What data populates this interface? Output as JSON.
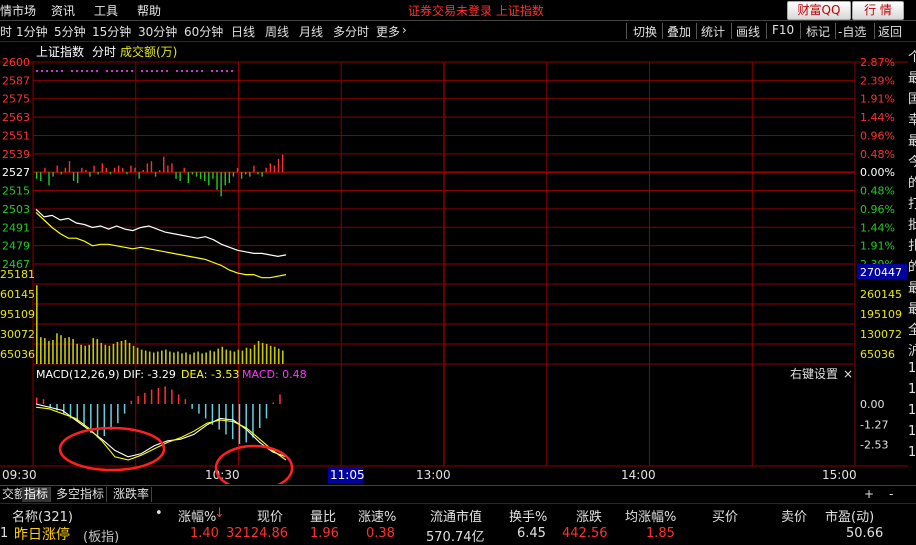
{
  "menu": {
    "items": [
      "情市场",
      "资讯",
      "工具",
      "帮助"
    ],
    "notice": "证券交易未登录 上证指数",
    "btn_caifu": "财富QQ",
    "btn_hangqing": "行 情"
  },
  "toolbar": {
    "periods": [
      "时",
      "1分钟",
      "5分钟",
      "15分钟",
      "30分钟",
      "60分钟",
      "日线",
      "周线",
      "月线",
      "多分时",
      "更多"
    ],
    "more_arrow": "›",
    "buttons": [
      "切换",
      "叠加",
      "统计",
      "画线",
      "F10",
      "标记",
      "-自选",
      "返回"
    ]
  },
  "chart": {
    "index_name": "上证指数",
    "mode": "分时",
    "volume_label": "成交额(万)",
    "macd_label": "MACD(12,26,9)",
    "dif_label": "DIF: -3.29",
    "dea_label": "DEA: -3.53",
    "macd_value": "MACD: 0.48",
    "macd_settings": "右键设置",
    "close_icon": "×",
    "cursor_value": "270447",
    "time_labels": [
      "09:30",
      "10:30",
      "11:05",
      "13:00",
      "14:00",
      "15:00"
    ],
    "macd_right_labels": [
      "0.00",
      "-1.27",
      "-2.53"
    ]
  },
  "chart_data": {
    "type": "line",
    "price_axis": [
      2600,
      2587,
      2575,
      2563,
      2551,
      2539,
      2527,
      2515,
      2503,
      2491,
      2479,
      2467
    ],
    "pct_axis": [
      "2.87%",
      "2.39%",
      "1.91%",
      "1.44%",
      "0.96%",
      "0.48%",
      "0.00%",
      "0.48%",
      "0.96%",
      "1.44%",
      "1.91%",
      "2.39%"
    ],
    "volume_axis_left": [
      "25181",
      "60145",
      "95109",
      "30072",
      "65036"
    ],
    "volume_axis_right": [
      "325181",
      "260145",
      "195109",
      "130072",
      "65036"
    ],
    "white_line": [
      2503,
      2498,
      2499,
      2496,
      2497,
      2494,
      2493,
      2491,
      2492,
      2490,
      2492,
      2490,
      2489,
      2491,
      2492,
      2490,
      2488,
      2487,
      2486,
      2485,
      2484,
      2485,
      2483,
      2480,
      2478,
      2476,
      2475,
      2474,
      2474,
      2473,
      2472,
      2473
    ],
    "yellow_line": [
      2501,
      2496,
      2491,
      2487,
      2484,
      2484,
      2482,
      2479,
      2480,
      2480,
      2479,
      2478,
      2477,
      2478,
      2477,
      2476,
      2475,
      2474,
      2473,
      2472,
      2471,
      2470,
      2468,
      2466,
      2463,
      2461,
      2460,
      2460,
      2458,
      2458,
      2459,
      2460
    ],
    "bars": [
      -3,
      -4,
      2,
      -6,
      -2,
      3,
      -1,
      2,
      5,
      -4,
      -5,
      2,
      1,
      -2,
      3,
      -1,
      4,
      2,
      -1,
      2,
      3,
      2,
      -1,
      3,
      2,
      -3,
      1,
      4,
      5,
      -2,
      1,
      7,
      3,
      4,
      -3,
      -4,
      2,
      -5,
      -1,
      -2,
      -3,
      -4,
      -6,
      -3,
      -8,
      -11,
      -6,
      -5,
      -2,
      2,
      -3,
      -1,
      -2,
      3,
      -1,
      -2,
      2,
      4,
      3,
      6,
      8
    ],
    "volume": [
      0.82,
      0.28,
      0.27,
      0.24,
      0.25,
      0.32,
      0.3,
      0.27,
      0.28,
      0.26,
      0.21,
      0.2,
      0.19,
      0.2,
      0.27,
      0.26,
      0.22,
      0.2,
      0.19,
      0.21,
      0.23,
      0.24,
      0.25,
      0.22,
      0.19,
      0.17,
      0.15,
      0.14,
      0.13,
      0.12,
      0.13,
      0.14,
      0.15,
      0.13,
      0.12,
      0.13,
      0.11,
      0.12,
      0.1,
      0.12,
      0.13,
      0.11,
      0.12,
      0.14,
      0.13,
      0.16,
      0.18,
      0.15,
      0.14,
      0.13,
      0.15,
      0.14,
      0.17,
      0.16,
      0.2,
      0.24,
      0.22,
      0.21,
      0.19,
      0.18,
      0.16,
      0.14
    ],
    "macd_bars": [
      0.4,
      0.3,
      -0.2,
      -0.4,
      -0.6,
      -0.9,
      -1.1,
      -1.4,
      -1.8,
      -2.1,
      -2.0,
      -1.6,
      -1.2,
      -0.6,
      0.2,
      0.5,
      0.7,
      0.9,
      1.0,
      1.1,
      0.9,
      0.6,
      0.3,
      -0.3,
      -0.6,
      -0.9,
      -1.3,
      -1.6,
      -1.9,
      -2.2,
      -2.5,
      -2.4,
      -2.1,
      -1.5,
      -0.9,
      0.1,
      0.6
    ],
    "dif_line": [
      0.0,
      -0.2,
      -0.4,
      -1.0,
      -1.6,
      -2.2,
      -2.9,
      -3.3,
      -3.1,
      -2.6,
      -2.3,
      -2.2,
      -1.9,
      -1.3,
      -0.9,
      -1.0,
      -1.6,
      -2.4,
      -3.0,
      -3.3
    ],
    "dea_line": [
      -0.2,
      -0.3,
      -0.6,
      -0.9,
      -1.5,
      -2.3,
      -3.3,
      -3.5,
      -3.2,
      -2.8,
      -2.4,
      -2.1,
      -1.7,
      -1.2,
      -1.0,
      -1.1,
      -1.5,
      -2.2,
      -2.9,
      -3.5
    ]
  },
  "tabs": [
    "交额",
    "指标",
    "多空指标",
    "涨跌率"
  ],
  "tab_controls": [
    "+",
    "-"
  ],
  "list": {
    "headers": [
      "名称(321)",
      "•",
      "涨幅%",
      "现价",
      "量比",
      "涨速%",
      "流通市值",
      "换手%",
      "涨跌",
      "均涨幅%",
      "买价",
      "卖价",
      "市盈(动)"
    ],
    "sort_marker": "↓",
    "row": {
      "index": "1",
      "name": "昨日涨停",
      "tag": "(板指)",
      "cells": [
        "1.40",
        "32124.86",
        "1.96",
        "0.38",
        "570.74亿",
        "6.45",
        "442.56",
        "1.85",
        "",
        "",
        "50.66"
      ]
    }
  },
  "right_strip_chars": [
    "个",
    "最",
    "国",
    "幸",
    "最",
    "今",
    "的",
    "打",
    "批",
    "扎",
    "的",
    "最",
    "最",
    "全",
    "沪",
    "1",
    "1",
    "1",
    "1",
    "1"
  ],
  "colors": {
    "grid": "#8b0000",
    "up": "#ff3030",
    "down": "#22cc22",
    "white_line": "#ffffff",
    "avg_line": "#ffff00",
    "volume_bar": "#c8c800",
    "macd_pos": "#ff3030",
    "macd_neg": "#66d0e0",
    "accent_blue": "#0000a0",
    "highlight_circle": "#ff2020"
  }
}
